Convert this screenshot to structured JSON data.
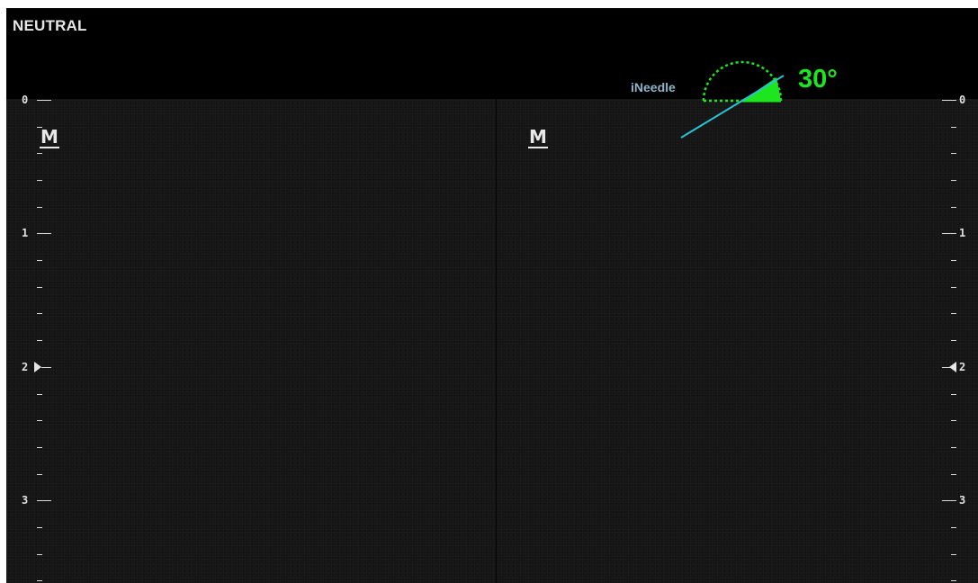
{
  "status": {
    "mode": "NEUTRAL"
  },
  "needle_guide": {
    "label": "iNeedle",
    "angle_text": "30°",
    "angle_degrees": 30,
    "gauge_color": "#1ee61e",
    "needle_color": "#29c3d6"
  },
  "panes": [
    {
      "orientation_marker": "M"
    },
    {
      "orientation_marker": "M"
    }
  ],
  "depth_scale": {
    "left_labels": [
      "0",
      "1",
      "2",
      "3"
    ],
    "right_labels": [
      "0",
      "1",
      "2",
      "3"
    ],
    "focus_depth": "2"
  },
  "colors": {
    "background": "#000000",
    "image_field": "#151515",
    "scale_text": "#e0e0e0"
  }
}
